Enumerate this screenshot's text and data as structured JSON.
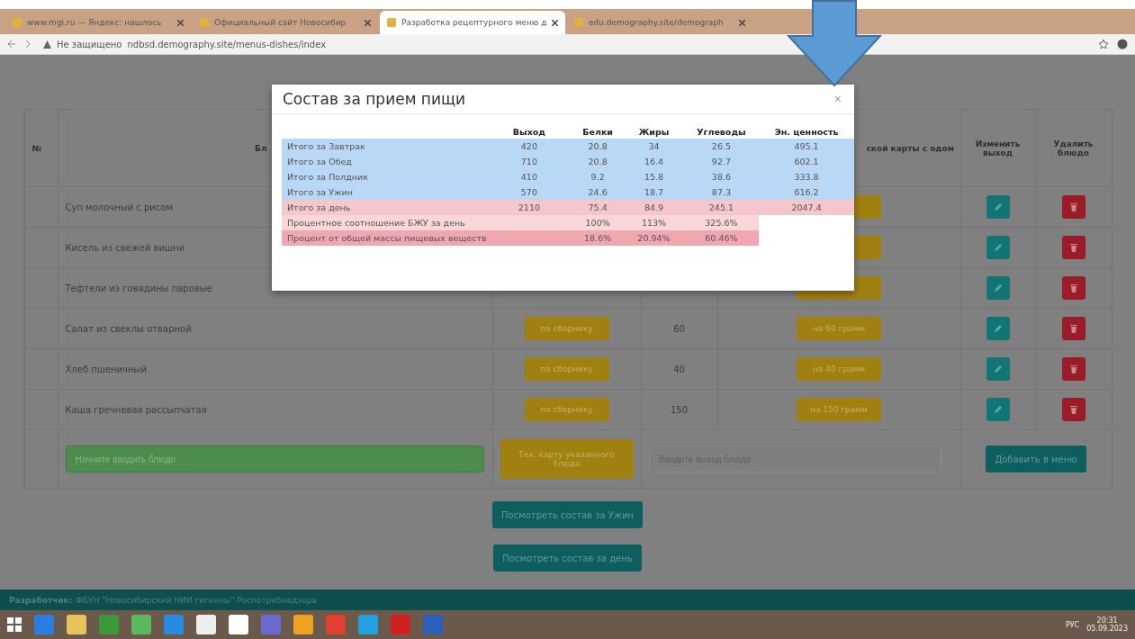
{
  "browser": {
    "tabs": [
      {
        "title": "www.mgi.ru — Яндекс: нашлось",
        "selected": false
      },
      {
        "title": "Официальный сайт Новосибир",
        "selected": false
      },
      {
        "title": "Разработка рецептурного меню д",
        "selected": true
      },
      {
        "title": "edu.demography.site/demograph",
        "selected": false
      }
    ],
    "address": {
      "security": "Не защищено",
      "url": "ndbsd.demography.site/menus-dishes/index"
    }
  },
  "table": {
    "columns": [
      "№",
      "Бл",
      "",
      "",
      "ской карты с одом",
      "Изменить выход",
      "Удалить блюдо"
    ],
    "rows": [
      {
        "dish": "Суп молочный с рисом",
        "tech": null,
        "weight": null,
        "card": null
      },
      {
        "dish": "Кисель из свежей вишни",
        "tech": null,
        "weight": null,
        "card": null
      },
      {
        "dish": "Тефтели из говядины паровые",
        "tech": null,
        "weight": null,
        "card": null
      },
      {
        "dish": "Салат из свеклы отварной",
        "tech": "по сборнику",
        "weight": "60",
        "card": "на 60 грамм"
      },
      {
        "dish": "Хлеб пшеничный",
        "tech": "по сборнику",
        "weight": "40",
        "card": "на 40 грамм"
      },
      {
        "dish": "Каша гречневая рассыпчатая",
        "tech": "по сборнику",
        "weight": "150",
        "card": "на 150 грамм"
      }
    ],
    "new_row": {
      "dish_placeholder": "Начните вводить блюдо",
      "card_button": "Тех. карту указанного блюда",
      "weight_placeholder": "Введите выход блюда",
      "add_button": "Добавить в меню"
    }
  },
  "actions": [
    "Посмотреть состав за Ужин",
    "Посмотреть состав за день"
  ],
  "footer": {
    "label": "Разработчик:",
    "text": "ФБУН \"Новосибирский НИИ гигиены\" Роспотребнадзора"
  },
  "modal": {
    "title": "Состав за прием пищи",
    "close": "×",
    "columns": [
      "Выход",
      "Белки",
      "Жиры",
      "Углеводы",
      "Эн. ценность"
    ],
    "rows": [
      {
        "kind": "meal",
        "label": "Итого за Завтрак",
        "values": [
          "420",
          "20.8",
          "34",
          "26.5",
          "495.1"
        ]
      },
      {
        "kind": "meal",
        "label": "Итого за Обед",
        "values": [
          "710",
          "20.8",
          "16.4",
          "92.7",
          "602.1"
        ]
      },
      {
        "kind": "meal",
        "label": "Итого за Полдник",
        "values": [
          "410",
          "9.2",
          "15.8",
          "38.6",
          "333.8"
        ]
      },
      {
        "kind": "meal",
        "label": "Итого за Ужин",
        "values": [
          "570",
          "24.6",
          "18.7",
          "87.3",
          "616.2"
        ]
      },
      {
        "kind": "day",
        "label": "Итого за день",
        "values": [
          "2110",
          "75.4",
          "84.9",
          "245.1",
          "2047.4"
        ]
      },
      {
        "kind": "ratio",
        "label": "Процентное соотношение БЖУ за день",
        "values": [
          "100%",
          "113%",
          "325.6%"
        ]
      },
      {
        "kind": "percent",
        "label": "Процент от общей массы пищевых веществ",
        "values": [
          "18.6%",
          "20.94%",
          "60.46%"
        ]
      }
    ]
  },
  "taskbar": {
    "language": "РУС",
    "time": "20:31",
    "date": "05.09.2023"
  }
}
